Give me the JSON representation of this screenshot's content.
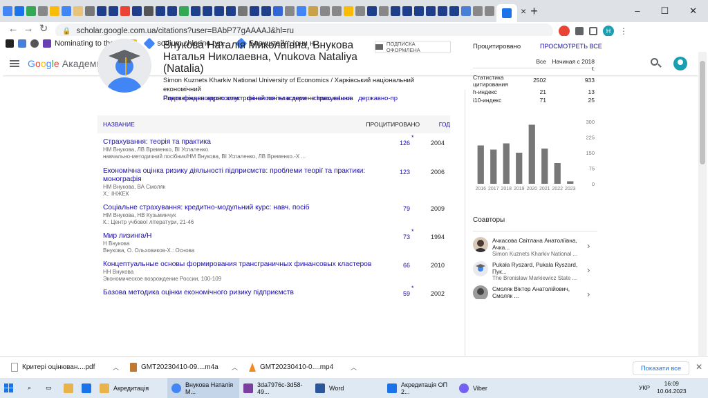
{
  "browser": {
    "tabs": {
      "active_close": "×",
      "new_tab": "+"
    },
    "window_controls": {
      "minimize": "–",
      "maximize": "☐",
      "close": "✕"
    },
    "url": "scholar.google.com.ua/citations?user=BAbP77gAAAAJ&hl=ru",
    "profile_initial": "H",
    "bookmarks": [
      "Nominating to the...",
      "sodium chlorine typ...",
      "Блауштайн: Іони н..."
    ]
  },
  "scholar": {
    "logo": {
      "g": "G",
      "o1": "o",
      "o2": "o",
      "g2": "g",
      "l": "l",
      "e": "e",
      "product": "Академия"
    },
    "profile": {
      "name": "Внукова Наталія Миколаївна, Внукова Наталья Николаевна, Vnukova Nataliya (Natalia)",
      "subscribe": "ПОДПИСКА ОФОРМЛЕНА",
      "affiliation": "Simon Kuznets Kharkiv National University of Economics / Харківський національний економічний",
      "email_verified": "Подтвержден адрес электронной почты в домене hneu.edu.ua",
      "interests": [
        "Ринок фінансових послуг",
        "фінансові кластери",
        "страхування",
        "державно-пр"
      ]
    },
    "table": {
      "col_title": "НАЗВАНИЕ",
      "col_cited": "ПРОЦИТИРОВАНО",
      "col_year": "ГОД",
      "articles": [
        {
          "title": "Страхування: теорія та практика",
          "authors": "НМ Внукова, ЛВ Временко, ВІ Успаленко",
          "venue": "навчально-методичний посібник/НМ Внукова, ВІ Успаленко, ЛВ Временко.-Х ...",
          "cited": "126",
          "star": "*",
          "year": "2004"
        },
        {
          "title": "Економічна оцінка ризику діяльності підприємств: проблеми теорії та практики:",
          "title2": "монографія",
          "authors": "НМ Внукова, ВА Смоляк",
          "venue": "Х.: ІНЖЕК",
          "cited": "123",
          "star": "",
          "year": "2006"
        },
        {
          "title": "Соціальне страхування: кредитно-модульний курс: навч. посіб",
          "authors": "НМ Внукова, НВ Кузьминчук",
          "venue": "К.: Центр учбової літератури, 21-46",
          "cited": "79",
          "star": "",
          "year": "2009"
        },
        {
          "title": "Мир лизинга/Н",
          "authors": "Н Внукова",
          "venue": "Внукова, О. Ольховиков-Х.: Основа",
          "cited": "73",
          "star": "*",
          "year": "1994"
        },
        {
          "title": "Концептуальные основы формирования трансграничных финансовых кластеров",
          "authors": "НН Внукова",
          "venue": "Экономическое возрождение России, 100-109",
          "cited": "66",
          "star": "",
          "year": "2010"
        },
        {
          "title": "Базова методика оцінки економічного ризику підприємств",
          "authors": "",
          "venue": "",
          "cited": "59",
          "star": "*",
          "year": "2002"
        }
      ]
    },
    "citations": {
      "title": "Процитировано",
      "view_all": "ПРОСМОТРЕТЬ ВСЕ",
      "col_all": "Все",
      "col_since": "Начиная с 2018 г.",
      "rows": [
        {
          "label": "Статистика цитирования",
          "all": "2502",
          "since": "933"
        },
        {
          "label": "h-индекс",
          "all": "21",
          "since": "13"
        },
        {
          "label": "i10-индекс",
          "all": "71",
          "since": "25"
        }
      ]
    },
    "chart_data": {
      "type": "bar",
      "categories": [
        "2016",
        "2017",
        "2018",
        "2019",
        "2020",
        "2021",
        "2022",
        "2023"
      ],
      "values": [
        185,
        165,
        195,
        150,
        285,
        170,
        100,
        12
      ],
      "ylim": [
        0,
        300
      ],
      "yticks": [
        "300",
        "225",
        "150",
        "75",
        "0"
      ],
      "xlabel": "",
      "ylabel": "",
      "title": ""
    },
    "coauthors": {
      "title": "Соавторы",
      "items": [
        {
          "name": "Ачкасова Світлана Анатоліївна, Ачка...",
          "aff": "Simon Kuznets Kharkiv National ..."
        },
        {
          "name": "Pukała Ryszard, Pukala Ryszard, Пук...",
          "aff": "The Bronisław Markiewicz State ..."
        },
        {
          "name": "Смоляк Віктор Анатолійович, Смоляк ...",
          "aff": ""
        }
      ]
    }
  },
  "downloads": {
    "items": [
      {
        "name": "Критері оцінюван....pdf"
      },
      {
        "name": "GMT20230410-09....m4a"
      },
      {
        "name": "GMT20230410-0....mp4"
      }
    ],
    "show_all": "Показати все",
    "close": "✕"
  },
  "taskbar": {
    "apps": [
      {
        "label": "Акредитація"
      },
      {
        "label": "Внукова Наталія М..."
      },
      {
        "label": "3da7976c-3d58-49..."
      },
      {
        "label": "Word"
      },
      {
        "label": "Акредитація ОП 2..."
      },
      {
        "label": "Viber"
      }
    ],
    "lang": "УКР",
    "time": "16:09",
    "date": "10.04.2023"
  }
}
